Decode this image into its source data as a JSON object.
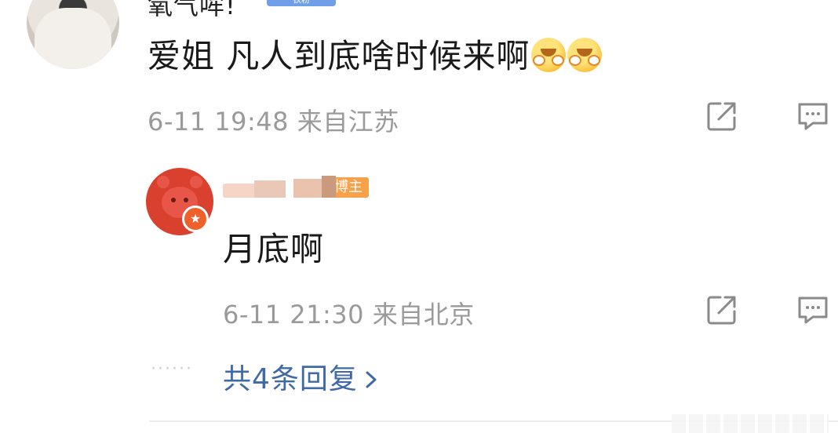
{
  "top_comment": {
    "username": "氧气哞!",
    "badge": "铁粉",
    "text": "爱姐 凡人到底啥时候来啊",
    "emojis": [
      "blushing-emoji",
      "blushing-emoji"
    ],
    "timestamp": "6-11 19:48",
    "location": "来自江苏"
  },
  "reply": {
    "author_badge": "博主",
    "text": "月底啊",
    "timestamp": "6-11 21:30",
    "location": "来自北京"
  },
  "more_replies": {
    "dots": "······",
    "label": "共4条回复"
  },
  "icons": {
    "share": "share-icon",
    "comment": "comment-icon",
    "chevron": "chevron-right-icon",
    "verified": "verified-badge-icon"
  },
  "colors": {
    "link": "#3f6aa6",
    "meta_text": "#9a9a9a",
    "author_badge": "#f7a14a",
    "fan_badge": "#6f9fe8"
  }
}
